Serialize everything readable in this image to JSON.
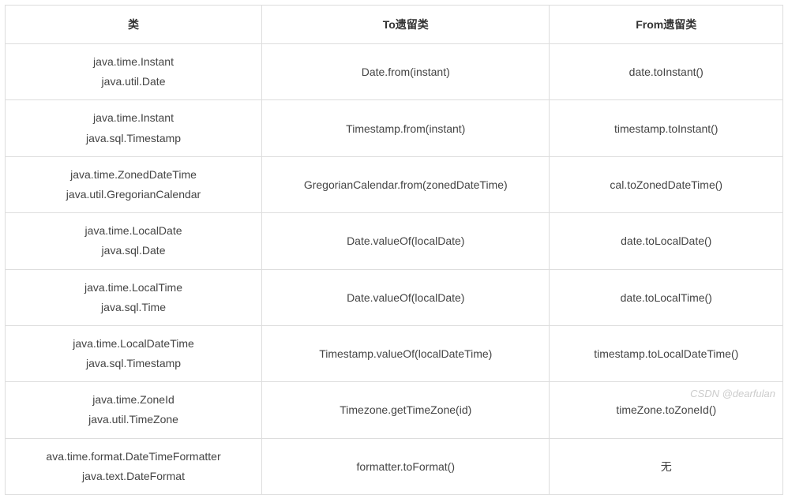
{
  "headers": {
    "col1": "类",
    "col2": "To遗留类",
    "col3": "From遗留类"
  },
  "rows": [
    {
      "class1": "java.time.Instant",
      "class2": "java.util.Date",
      "to": "Date.from(instant)",
      "from": "date.toInstant()"
    },
    {
      "class1": "java.time.Instant",
      "class2": "java.sql.Timestamp",
      "to": "Timestamp.from(instant)",
      "from": "timestamp.toInstant()"
    },
    {
      "class1": "java.time.ZonedDateTime",
      "class2": "java.util.GregorianCalendar",
      "to": "GregorianCalendar.from(zonedDateTime)",
      "from": "cal.toZonedDateTime()"
    },
    {
      "class1": "java.time.LocalDate",
      "class2": "java.sql.Date",
      "to": "Date.valueOf(localDate)",
      "from": "date.toLocalDate()"
    },
    {
      "class1": "java.time.LocalTime",
      "class2": "java.sql.Time",
      "to": "Date.valueOf(localDate)",
      "from": "date.toLocalTime()"
    },
    {
      "class1": "java.time.LocalDateTime",
      "class2": "java.sql.Timestamp",
      "to": "Timestamp.valueOf(localDateTime)",
      "from": "timestamp.toLocalDateTime()"
    },
    {
      "class1": "java.time.ZoneId",
      "class2": "java.util.TimeZone",
      "to": "Timezone.getTimeZone(id)",
      "from": "timeZone.toZoneId()"
    },
    {
      "class1": "ava.time.format.DateTimeFormatter",
      "class2": "java.text.DateFormat",
      "to": "formatter.toFormat()",
      "from": "无"
    }
  ],
  "watermark": "CSDN @dearfulan"
}
